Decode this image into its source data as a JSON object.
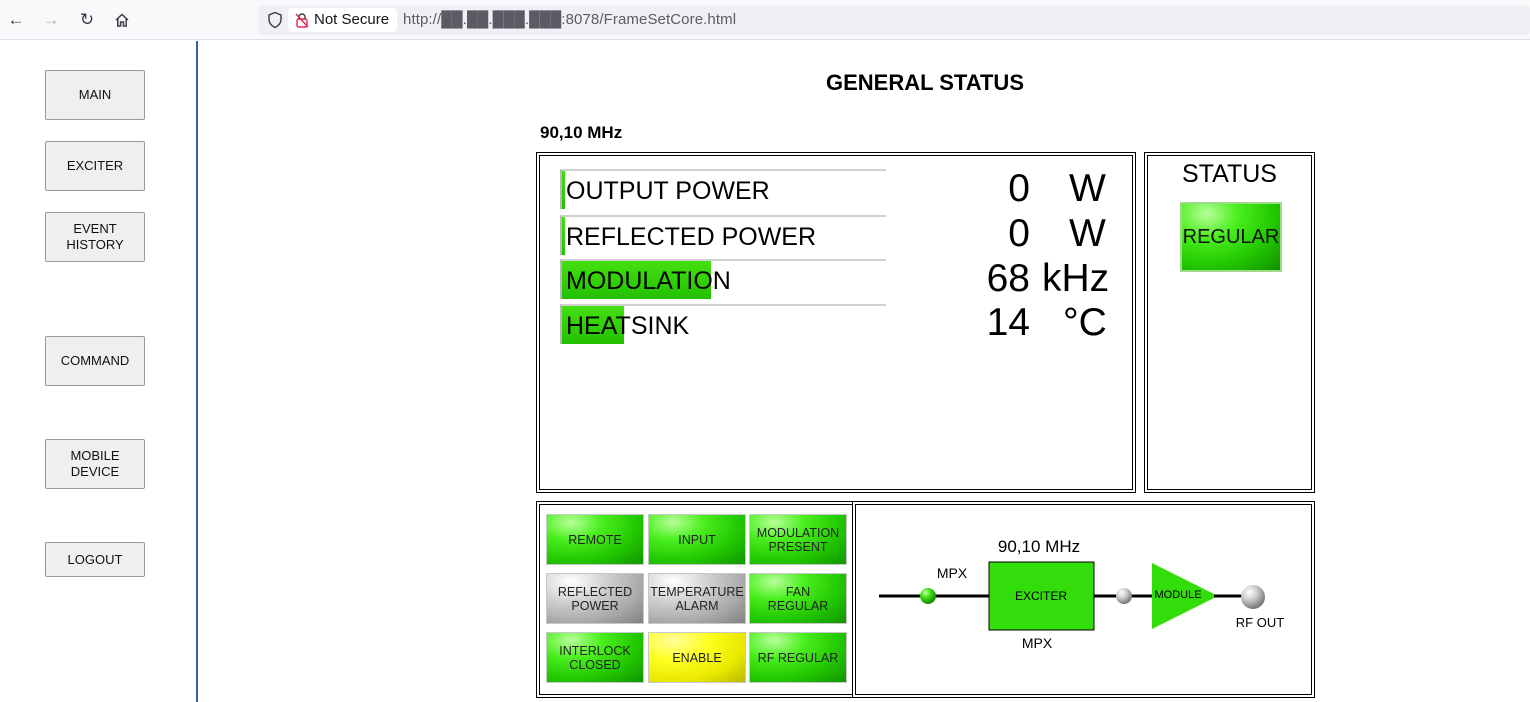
{
  "browser": {
    "security_label": "Not Secure",
    "url": "http://██.██.███.███:8078/FrameSetCore.html"
  },
  "sidebar": {
    "items": [
      {
        "label": "MAIN"
      },
      {
        "label": "EXCITER"
      },
      {
        "label": "EVENT HISTORY"
      },
      {
        "label": "COMMAND"
      },
      {
        "label": "MOBILE DEVICE"
      },
      {
        "label": "LOGOUT"
      }
    ]
  },
  "main": {
    "title": "GENERAL STATUS",
    "frequency": "90,10 MHz"
  },
  "measurements": [
    {
      "label": "OUTPUT POWER",
      "value": "0",
      "unit": "W",
      "level": 0.0
    },
    {
      "label": "REFLECTED POWER",
      "value": "0",
      "unit": "W",
      "level": 0.0
    },
    {
      "label": "MODULATION",
      "value": "68",
      "unit": "kHz",
      "level": 0.46
    },
    {
      "label": "HEATSINK",
      "value": "14",
      "unit": "°C",
      "level": 0.19
    }
  ],
  "status": {
    "title": "STATUS",
    "value": "REGULAR",
    "color": "#33d60a"
  },
  "alarms": [
    {
      "label": "REMOTE",
      "state": "green"
    },
    {
      "label": "INPUT",
      "state": "green"
    },
    {
      "label": "MODULATION PRESENT",
      "state": "green"
    },
    {
      "label": "REFLECTED POWER",
      "state": "gray"
    },
    {
      "label": "TEMPERATURE ALARM",
      "state": "gray"
    },
    {
      "label": "FAN REGULAR",
      "state": "green"
    },
    {
      "label": "INTERLOCK CLOSED",
      "state": "green"
    },
    {
      "label": "ENABLE",
      "state": "yellow"
    },
    {
      "label": "RF REGULAR",
      "state": "green"
    }
  ],
  "diagram": {
    "frequency": "90,10 MHz",
    "input_label_top": "MPX",
    "input_label_bottom": "MPX",
    "exciter_label": "EXCITER",
    "module_label": "MODULE",
    "output_label": "RF OUT"
  }
}
